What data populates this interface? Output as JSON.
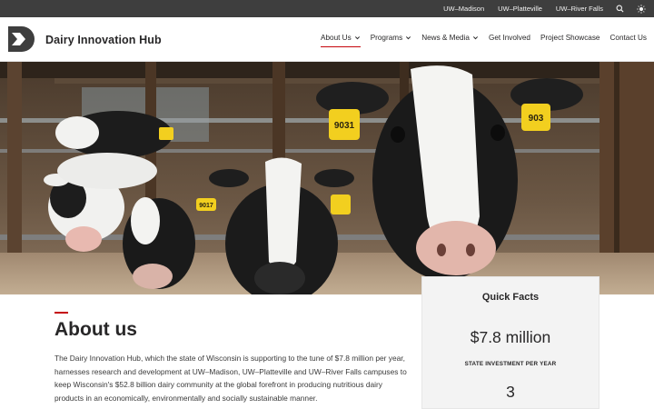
{
  "topbar": {
    "links": [
      "UW–Madison",
      "UW–Platteville",
      "UW–River Falls"
    ],
    "search_icon": "search-icon",
    "theme_icon": "sun-icon"
  },
  "header": {
    "title": "Dairy Innovation Hub",
    "logo_icon": "dairy-hub-logo-icon",
    "nav": [
      {
        "label": "About Us",
        "dropdown": true,
        "active": true
      },
      {
        "label": "Programs",
        "dropdown": true,
        "active": false
      },
      {
        "label": "News & Media",
        "dropdown": true,
        "active": false
      },
      {
        "label": "Get Involved",
        "dropdown": false,
        "active": false
      },
      {
        "label": "Project Showcase",
        "dropdown": false,
        "active": false
      },
      {
        "label": "Contact Us",
        "dropdown": false,
        "active": false
      }
    ]
  },
  "hero": {
    "ear_tags": [
      "9031",
      "903",
      "9017"
    ]
  },
  "about": {
    "heading": "About us",
    "body": "The Dairy Innovation Hub, which the state of Wisconsin is supporting to the tune of $7.8 million per year, harnesses research and development at UW–Madison, UW–Platteville and UW–River Falls campuses to keep Wisconsin's $52.8 billion dairy community at the global forefront in producing nutritious dairy products in an economically, environmentally and socially sustainable manner."
  },
  "quick_facts": {
    "title": "Quick Facts",
    "fact1_value": "$7.8 million",
    "fact1_caption": "STATE INVESTMENT PER YEAR",
    "fact2_value": "3"
  },
  "colors": {
    "topbar_bg": "#3e3e3e",
    "accent_red": "#c5050c",
    "tag_yellow": "#f2cf1f",
    "card_bg": "#f3f3f3"
  }
}
